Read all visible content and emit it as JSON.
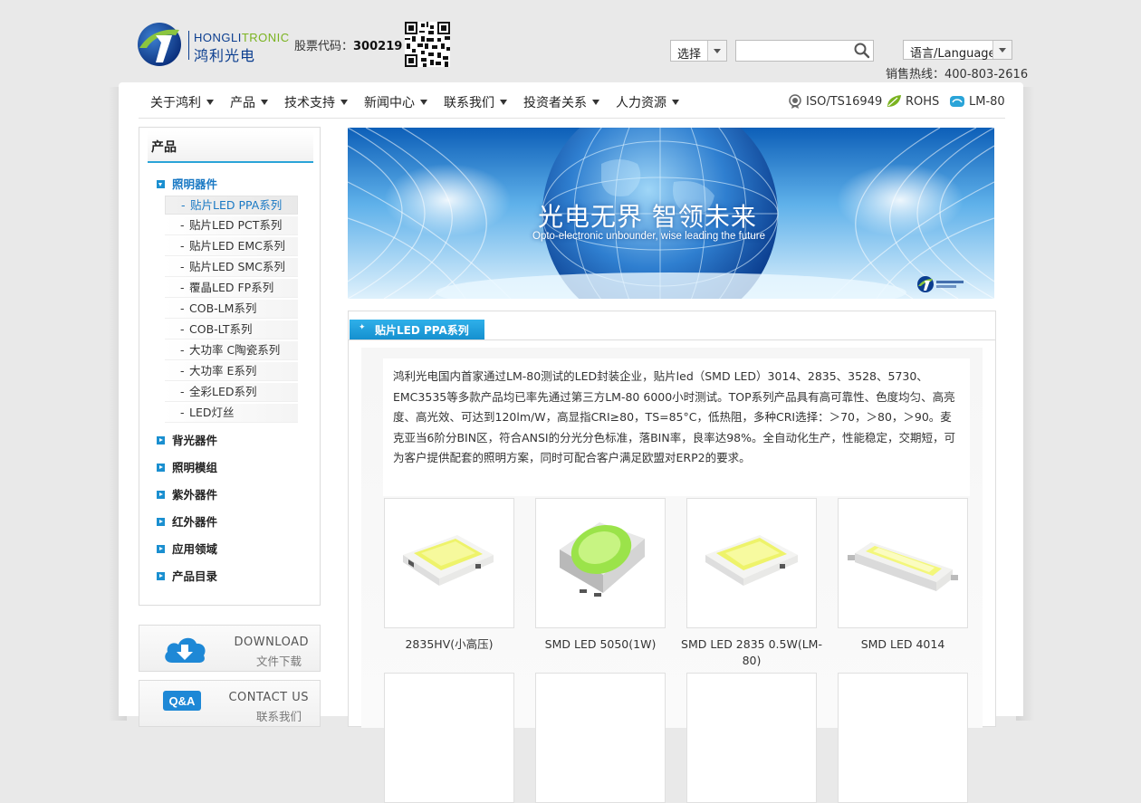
{
  "brand": {
    "name_part1": "HONGLI",
    "name_part2": "TRONIC",
    "name_cn": "鸿利光电",
    "stock_label": "股票代码：",
    "stock_code": "300219",
    "color_primary": "#0a3d8f",
    "color_accent": "#7ab320"
  },
  "search": {
    "select_value": "选择",
    "input_value": "",
    "button_icon": "search-icon"
  },
  "language": {
    "select_value": "语言/Language"
  },
  "hotline": "销售热线：400-803-2616",
  "nav": {
    "items": [
      "关于鸿利",
      "产品",
      "技术支持",
      "新闻中心",
      "联系我们",
      "投资者关系",
      "人力资源"
    ],
    "certs": [
      "ISO/TS16949",
      "ROHS",
      "LM-80"
    ]
  },
  "sidebar": {
    "title": "产品",
    "categories": [
      "照明器件",
      "背光器件",
      "照明模组",
      "紫外器件",
      "红外器件",
      "应用领域",
      "产品目录"
    ],
    "active_category": "照明器件",
    "subitems": [
      "贴片LED PPA系列",
      "贴片LED PCT系列",
      "贴片LED EMC系列",
      "贴片LED SMC系列",
      "覆晶LED FP系列",
      "COB-LM系列",
      "COB-LT系列",
      "大功率 C陶瓷系列",
      "大功率 E系列",
      "全彩LED系列",
      "LED灯丝"
    ],
    "active_subitem": "贴片LED PPA系列",
    "boxes": [
      {
        "en": "DOWNLOAD",
        "cn": "文件下载",
        "icon": "cloud-download-icon"
      },
      {
        "en": "CONTACT US",
        "cn": "联系我们",
        "icon": "qa-icon"
      }
    ]
  },
  "banner": {
    "title": "光电无界  智领未来",
    "subtitle": "Opto-electronic unbounder, wise leading the future"
  },
  "content": {
    "tab_label": "贴片LED PPA系列",
    "description": "鸿利光电国内首家通过LM-80测试的LED封装企业，贴片led（SMD LED）3014、2835、3528、5730、EMC3535等多款产品均已率先通过第三方LM-80 6000小时测试。TOP系列产品具有高可靠性、色度均匀、高亮度、高光效、可达到120lm/W，高显指CRI≥80，TS=85°C，低热阻，多种CRI选择：＞70，＞80，＞90。麦克亚当6阶分BIN区，符合ANSI的分光分色标准，落BIN率，良率达98%。全自动化生产，性能稳定，交期短，可为客户提供配套的照明方案，同时可配合客户满足欧盟对ERP2的要求。",
    "products": [
      {
        "name": "2835HV(小高压)",
        "image": "smd-led-2835hv-image"
      },
      {
        "name": "SMD LED 5050(1W)",
        "image": "smd-led-5050-image"
      },
      {
        "name": "SMD LED 2835 0.5W(LM-80)",
        "image": "smd-led-2835-image"
      },
      {
        "name": "SMD LED 4014",
        "image": "smd-led-4014-image"
      }
    ]
  }
}
